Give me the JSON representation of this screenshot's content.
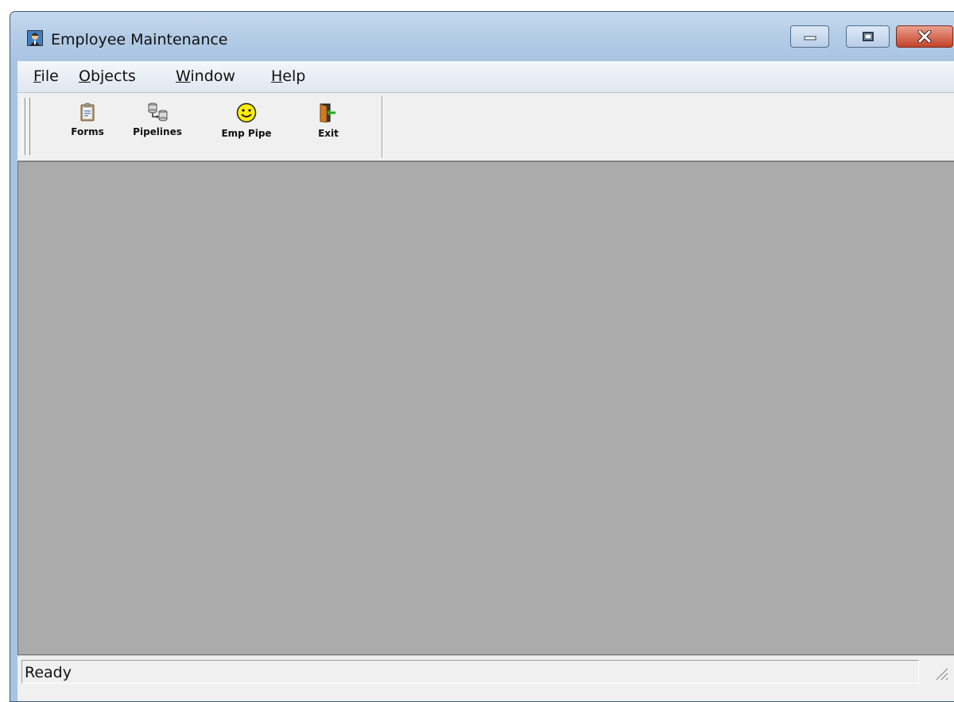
{
  "window": {
    "title": "Employee Maintenance",
    "icon": "employee-app-icon",
    "controls": {
      "minimize": "minimize-icon",
      "maximize": "maximize-icon",
      "close": "close-icon"
    }
  },
  "menubar": {
    "items": [
      {
        "accel": "F",
        "rest": "ile"
      },
      {
        "accel": "O",
        "rest": "bjects"
      },
      {
        "accel": "W",
        "rest": "indow"
      },
      {
        "accel": "H",
        "rest": "elp"
      }
    ]
  },
  "toolbar": {
    "buttons": [
      {
        "label": "Forms",
        "icon": "clipboard-form-icon"
      },
      {
        "label": "Pipelines",
        "icon": "database-pipeline-icon"
      },
      {
        "label": "Emp Pipe",
        "icon": "smiley-face-icon"
      },
      {
        "label": "Exit",
        "icon": "exit-door-icon"
      }
    ]
  },
  "statusbar": {
    "text": "Ready"
  },
  "colors": {
    "client_area": "#ababab",
    "close_button": "#c4432b",
    "titlebar": "#b4cce6"
  }
}
